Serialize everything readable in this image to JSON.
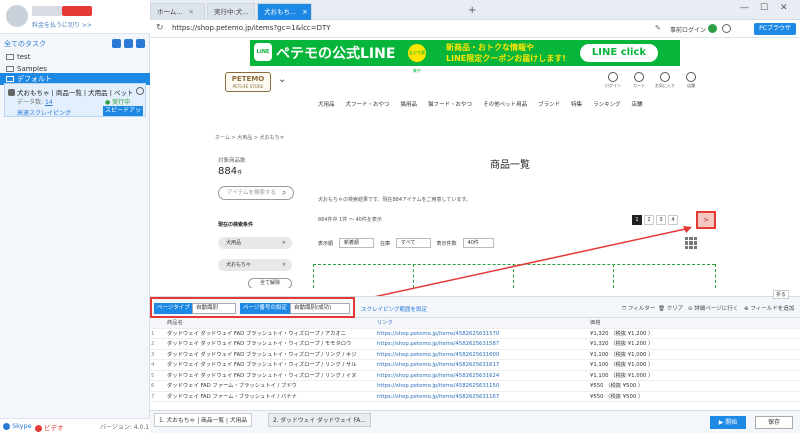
{
  "sidebar": {
    "account_sub": "料金を払うに切り >>",
    "all_tasks": "全てのタスク",
    "tree": [
      "test",
      "Samples",
      "デフォルト"
    ],
    "task": {
      "title": "犬おもちゃ | 商品一覧 | 犬用品 | ペット用…",
      "count_label": "データ数:",
      "count": "14",
      "status": "● 実行中",
      "mode": "高速スクレイピング",
      "speed_button": "スピードアップ"
    },
    "footer": {
      "skype": "Skype",
      "video": "ビデオ",
      "version": "バージョン: 4.0.1"
    }
  },
  "browser": {
    "tabs": [
      "ホーム...",
      "実行中:犬...",
      "犬おもち..."
    ],
    "url": "https://shop.petemo.jp/items?gc=1&lcc=DTY",
    "pre_login": "事前ログイン",
    "pc_browser": "PCブラウザ"
  },
  "site": {
    "banner": {
      "line_logo": "LINE",
      "main": "ペテモの公式LINE",
      "badge": "友だち募集中",
      "sub1": "新商品・おトクな情報や",
      "sub2": "LINE限定クーポンお届けします!",
      "click": "LINE click"
    },
    "logo": "PETEMO",
    "logo_sub": "PETLIFE STORE",
    "header_icons": [
      "ログイン",
      "カート",
      "お気に入り",
      "店舗"
    ],
    "nav": [
      "犬用品",
      "犬フード・おやつ",
      "猫用品",
      "猫フード・おやつ",
      "その他ペット用品",
      "ブランド",
      "特集",
      "ランキング",
      "店舗"
    ],
    "breadcrumb": "ホーム  >  犬用品  >  犬おもちゃ",
    "count_label": "対象商品数",
    "count_value": "884",
    "count_unit": "件",
    "search_placeholder": "アイテムを検索する",
    "current_conditions": "現在の検索条件",
    "chips": [
      "犬用品",
      "犬おもちゃ"
    ],
    "clear_all": "全て解除",
    "page_title": "商品一覧",
    "description": "犬おもちゃの検索結果です。現在884アイテムをご用意しています。",
    "range": "884件中 1件 〜 40件を表示",
    "pages": [
      "1",
      "2",
      "3",
      "4"
    ],
    "next": ">",
    "sort_label": "表示順",
    "sort_value": "新着順",
    "stock_label": "在庫",
    "stock_value": "すべて",
    "per_page_label": "表示件数",
    "per_page_value": "40件"
  },
  "toolbar": {
    "page_type_label": "ページタイプ",
    "page_type_value": "自動識別",
    "page_num_label": "ページ番号の設定",
    "page_num_value": "自動識別(成功)",
    "scrape_range": "スクレイピング範囲を設定",
    "fold": "折る",
    "filter": "フィルター",
    "clear": "クリア",
    "detail": "詳細ページに行く",
    "add_field": "フィールドを追加"
  },
  "table": {
    "headers": [
      "商品名",
      "リンク",
      "価格"
    ],
    "rows": [
      {
        "n": "1",
        "name": "ダッドウェイ ダッドウェイ FAD ブラッシュトイ・ウィズロープ / アカオニ",
        "link": "https://shop.petemo.jp/items/4582625631570",
        "price": "¥1,320 （税抜 ¥1,200 ）"
      },
      {
        "n": "2",
        "name": "ダッドウェイ ダッドウェイ FAD ブラッシュトイ・ウィズロープ / モモタロウ",
        "link": "https://shop.petemo.jp/items/4582625631587",
        "price": "¥1,320 （税抜 ¥1,200 ）"
      },
      {
        "n": "3",
        "name": "ダッドウェイ ダッドウェイ FAD ブラッシュトイ・ウィズロープ / リング / キジ",
        "link": "https://shop.petemo.jp/items/4582625631600",
        "price": "¥1,100 （税抜 ¥1,000 ）"
      },
      {
        "n": "4",
        "name": "ダッドウェイ ダッドウェイ FAD ブラッシュトイ・ウィズロープ / リング / サル",
        "link": "https://shop.petemo.jp/items/4582625631617",
        "price": "¥1,100 （税抜 ¥1,000 ）"
      },
      {
        "n": "5",
        "name": "ダッドウェイ ダッドウェイ FAD ブラッシュトイ・ウィズロープ / リング / イヌ",
        "link": "https://shop.petemo.jp/items/4582625631624",
        "price": "¥1,100 （税抜 ¥1,000 ）"
      },
      {
        "n": "6",
        "name": "ダッドウェイ FAD ファーム・ブラッシュトイ / ブドウ",
        "link": "https://shop.petemo.jp/items/4582625631150",
        "price": "¥550 （税抜 ¥500 ）"
      },
      {
        "n": "7",
        "name": "ダッドウェイ FAD ファーム・ブラッシュトイ / バナナ",
        "link": "https://shop.petemo.jp/items/4582625631167",
        "price": "¥550 （税抜 ¥500 ）"
      }
    ]
  },
  "bottom": {
    "tabs": [
      "1. 犬おもちゃ | 商品一覧 | 犬用品",
      "2. ダッドウェイ ダッドウェイ FA..."
    ],
    "start": "▶ 開始",
    "save": "保存"
  },
  "colors": {
    "accent": "#1e88e5",
    "line_green": "#07b53b",
    "highlight_red": "#e53935"
  }
}
